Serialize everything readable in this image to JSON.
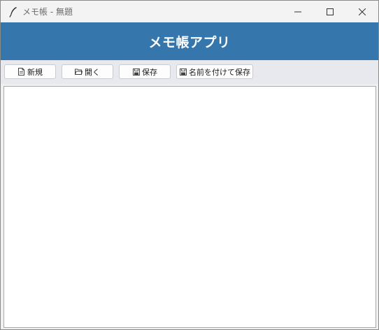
{
  "window": {
    "title": "メモ帳 - 無題"
  },
  "header": {
    "title": "メモ帳アプリ"
  },
  "toolbar": {
    "buttons": [
      {
        "label": "新規",
        "icon": "new-file-icon"
      },
      {
        "label": "開く",
        "icon": "folder-open-icon"
      },
      {
        "label": "保存",
        "icon": "save-icon"
      },
      {
        "label": "名前を付けて保存",
        "icon": "save-as-icon"
      }
    ]
  },
  "editor": {
    "value": ""
  },
  "colors": {
    "header_bg": "#3577ad",
    "toolbar_bg": "#e8e9ee",
    "titlebar_bg": "#f3f3f3"
  }
}
